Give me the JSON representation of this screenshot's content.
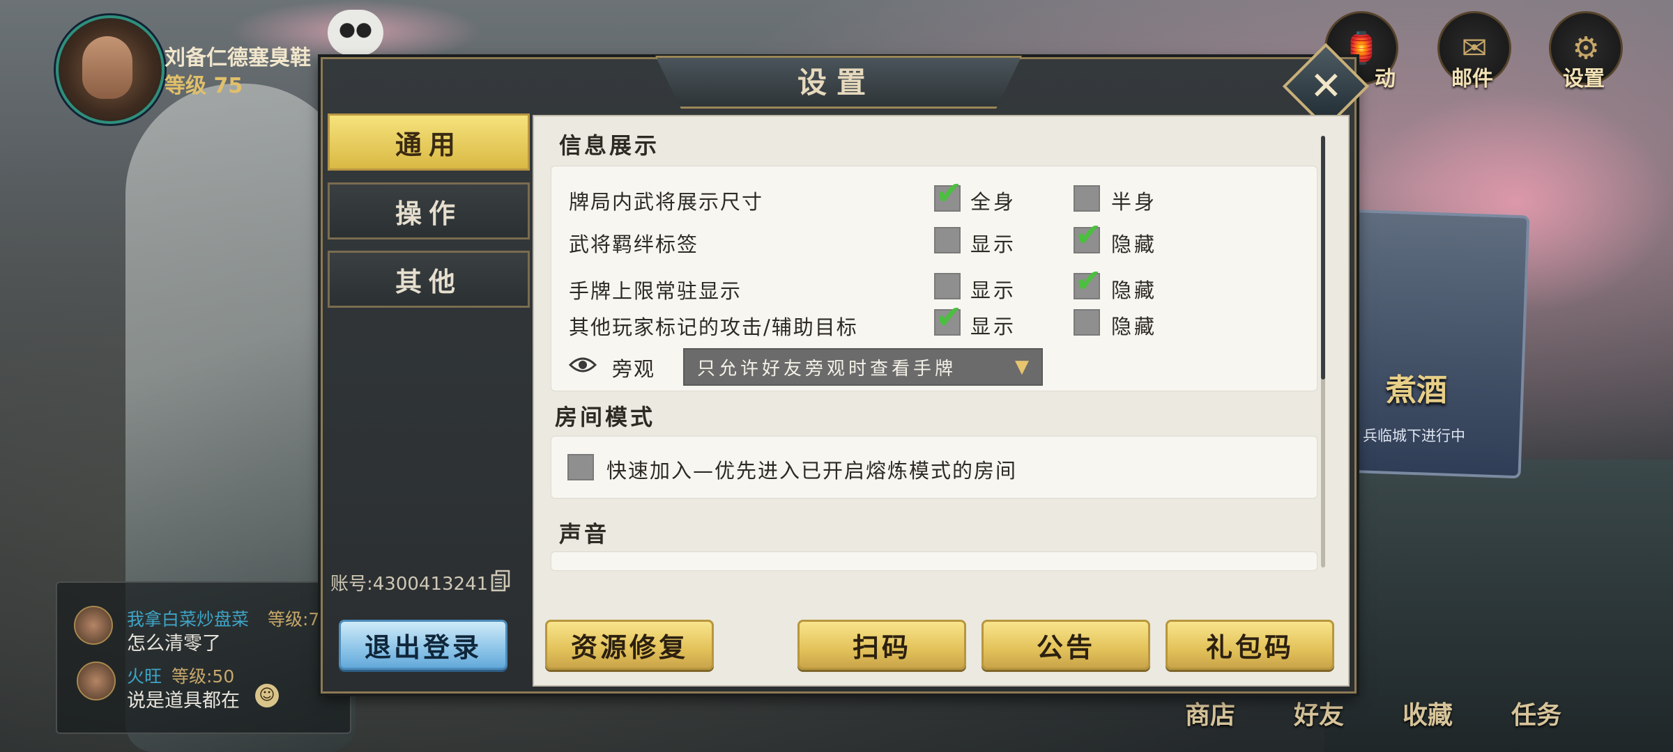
{
  "player": {
    "name": "刘备仁德塞臭鞋",
    "level_text": "等级 75"
  },
  "top_icons": [
    {
      "label": "动",
      "icon": "lantern-icon"
    },
    {
      "label": "邮件",
      "icon": "mail-icon"
    },
    {
      "label": "设置",
      "icon": "settings-icon"
    }
  ],
  "event": {
    "title": "煮酒",
    "subtitle": "兵临城下进行中"
  },
  "chat": {
    "messages": [
      {
        "name": "我拿白菜炒盘菜",
        "level": "等级:7",
        "text": "怎么清零了"
      },
      {
        "name": "火旺",
        "level": "等级:50",
        "text": "说是道具都在"
      }
    ]
  },
  "bottom_nav": [
    "商店",
    "好友",
    "收藏",
    "任务"
  ],
  "settings": {
    "title": "设置",
    "close_label": "✕",
    "tabs": [
      "通用",
      "操作",
      "其他"
    ],
    "active_tab": "通用",
    "sections": {
      "info": "信息展示",
      "room": "房间模式",
      "sound": "声音"
    },
    "rows": [
      {
        "label": "牌局内武将展示尺寸",
        "options": [
          "全身",
          "半身"
        ],
        "checked": "全身"
      },
      {
        "label": "武将羁绊标签",
        "options": [
          "显示",
          "隐藏"
        ],
        "checked": "隐藏"
      },
      {
        "label": "手牌上限常驻显示",
        "options": [
          "显示",
          "隐藏"
        ],
        "checked": "隐藏"
      },
      {
        "label": "其他玩家标记的攻击/辅助目标",
        "options": [
          "显示",
          "隐藏"
        ],
        "checked": "显示"
      }
    ],
    "spectate": {
      "label": "旁观",
      "value": "只允许好友旁观时查看手牌"
    },
    "quick_join": {
      "label": "快速加入—优先进入已开启熔炼模式的房间",
      "checked": false
    },
    "account": "账号:4300413241",
    "buttons": {
      "logout": "退出登录",
      "repair": "资源修复",
      "scan": "扫码",
      "notice": "公告",
      "gift": "礼包码"
    }
  },
  "colors": {
    "gold": "#e3c25a",
    "check_green": "#4bbf3f",
    "panel_bg": "#ebe9e0",
    "frame_border": "#8d7a54"
  }
}
